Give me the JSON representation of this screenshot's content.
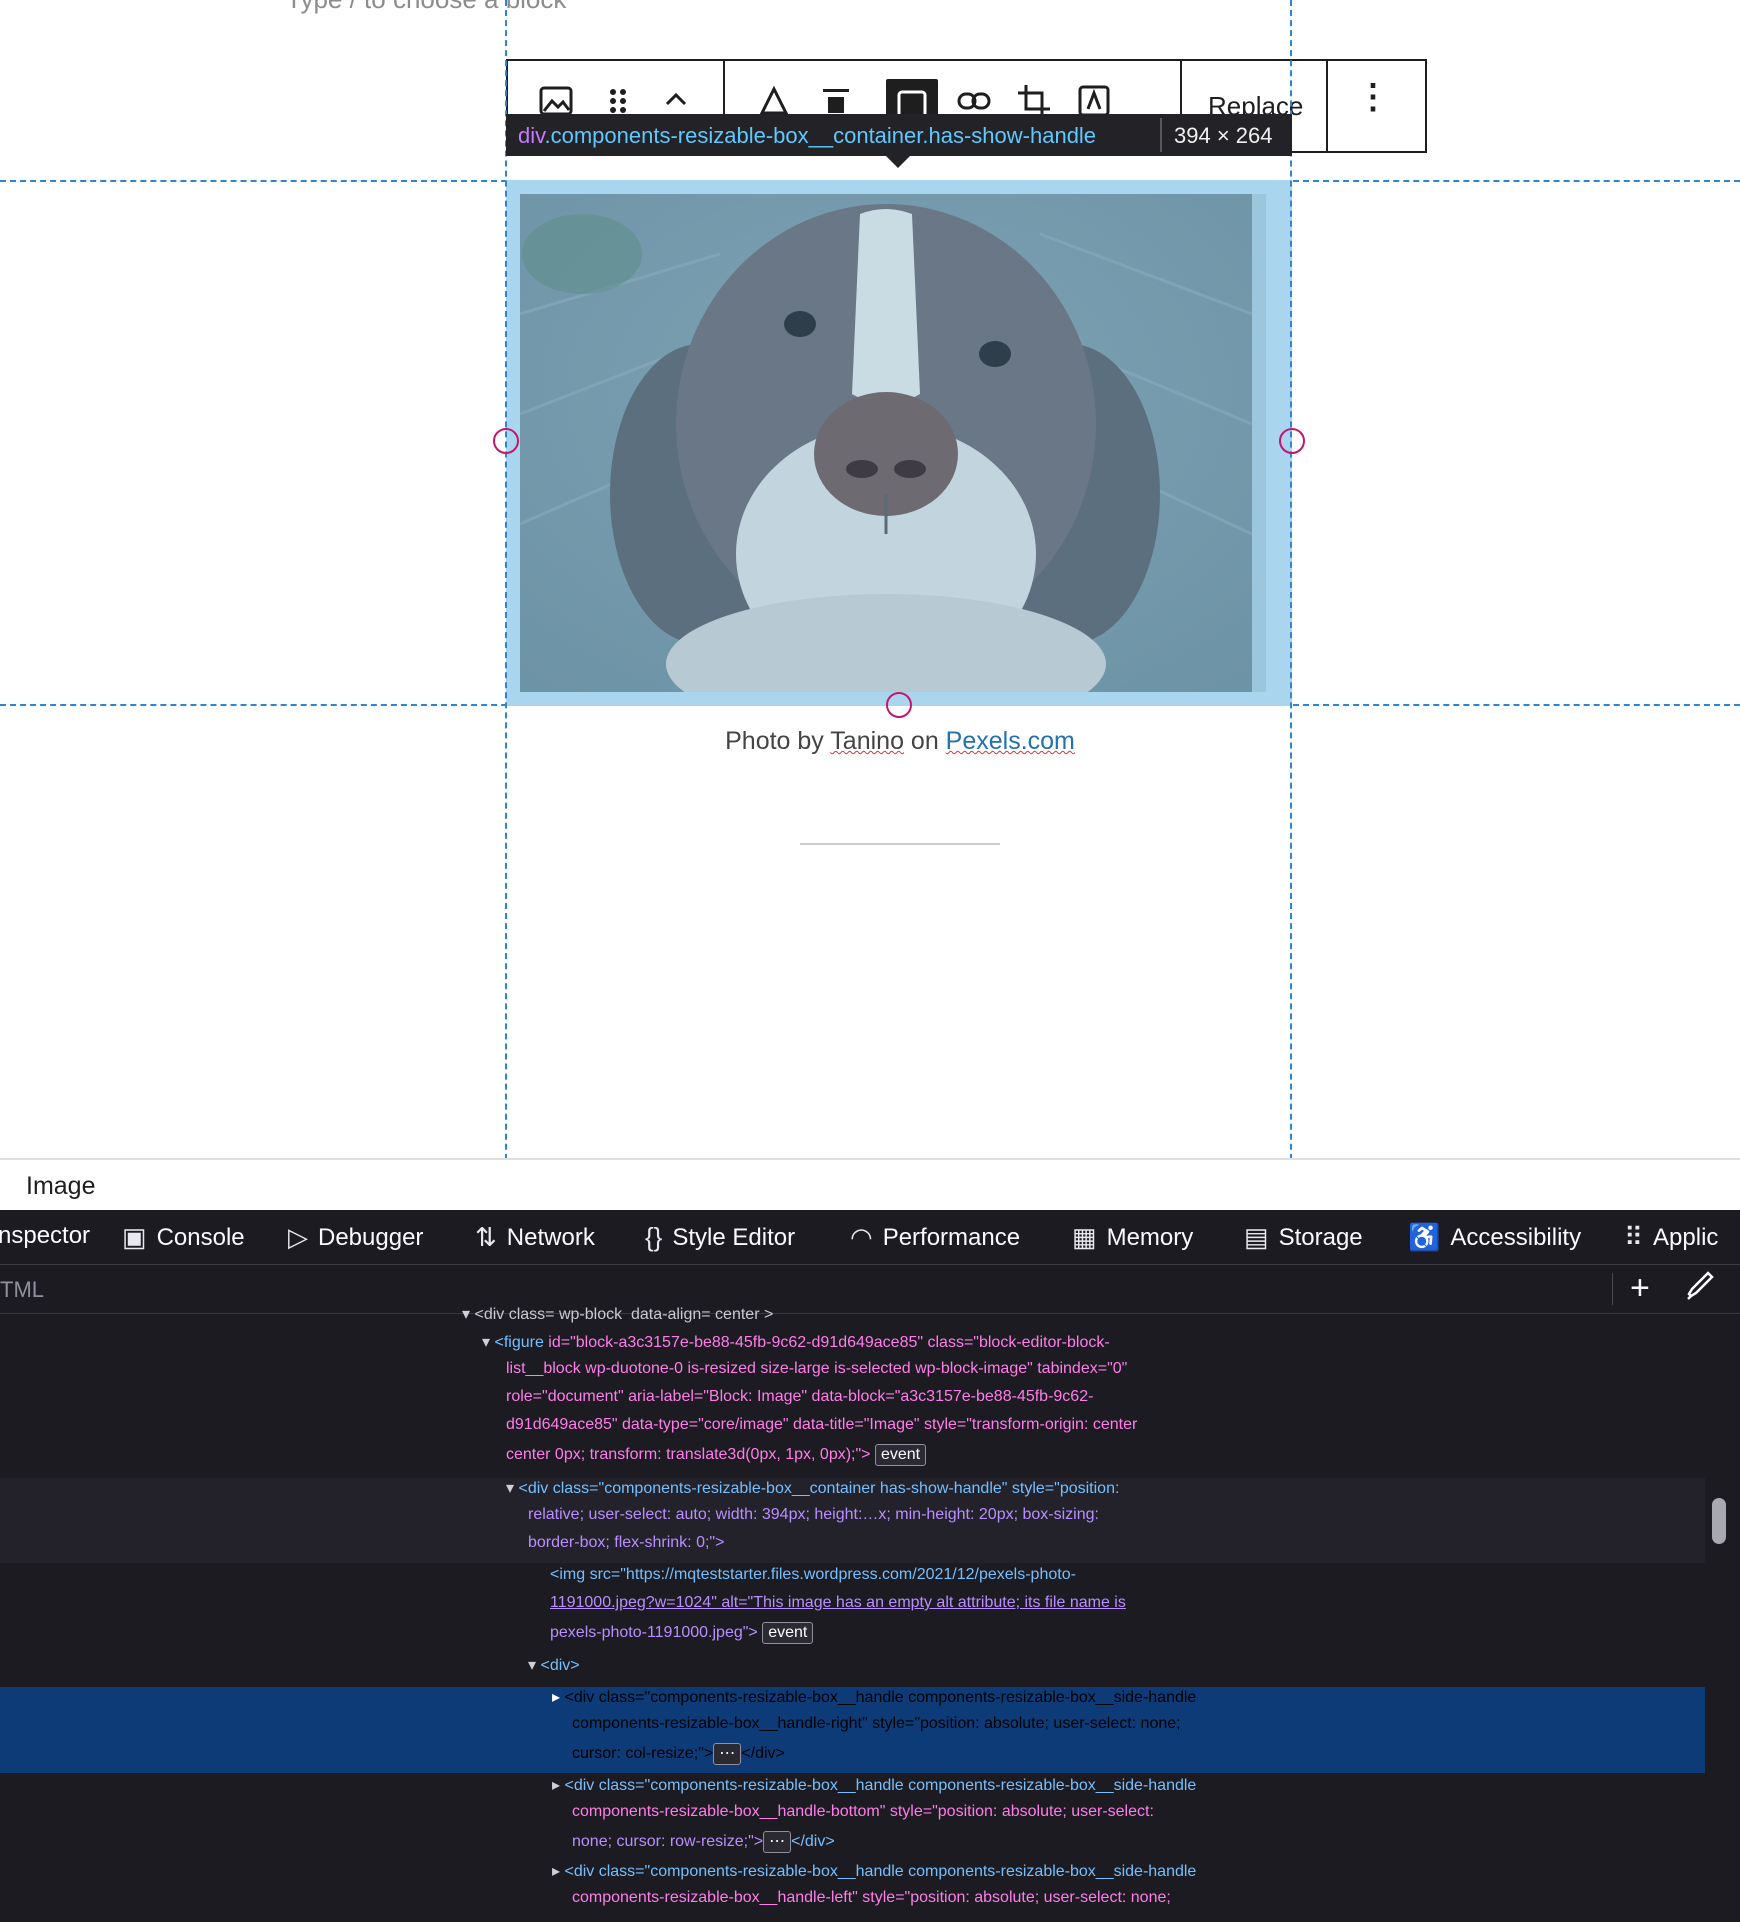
{
  "editor": {
    "placeholder": "Type / to choose a block",
    "toolbar": {
      "replace_label": "Replace",
      "more_label": "⋮",
      "buttons": [
        {
          "name": "image-block-icon",
          "glyph": "▨"
        },
        {
          "name": "drag-handle-icon",
          "glyph": "⠿"
        },
        {
          "name": "move-up-icon",
          "glyph": "⌃"
        },
        {
          "name": "duotone-icon",
          "glyph": "◭"
        },
        {
          "name": "align-icon",
          "glyph": "▬"
        },
        {
          "name": "crop-box-icon",
          "glyph": "▢"
        },
        {
          "name": "link-icon",
          "glyph": "⛓"
        },
        {
          "name": "crop-icon",
          "glyph": "⌐"
        },
        {
          "name": "text-overlay-icon",
          "glyph": "A"
        }
      ]
    },
    "inspector_tooltip": {
      "tag": "div",
      "classes": ".components-resizable-box__container.has-show-handle",
      "dimensions": "394 × 264"
    },
    "caption": {
      "prefix": "Photo by ",
      "author": "Tanino",
      "middle": " on ",
      "link": "Pexels.com"
    },
    "breadcrumb": "Image"
  },
  "devtools": {
    "tabs": [
      {
        "label": "nspector",
        "icon": ""
      },
      {
        "label": "Console",
        "icon": "▣"
      },
      {
        "label": "Debugger",
        "icon": "▷"
      },
      {
        "label": "Network",
        "icon": "⇅"
      },
      {
        "label": "Style Editor",
        "icon": "{}"
      },
      {
        "label": "Performance",
        "icon": "◠"
      },
      {
        "label": "Memory",
        "icon": "▦"
      },
      {
        "label": "Storage",
        "icon": "▤"
      },
      {
        "label": "Accessibility",
        "icon": "♿"
      },
      {
        "label": "Applic",
        "icon": "⠿"
      }
    ],
    "search_placeholder": "TML",
    "code": {
      "l0": "<div class= wp-block  data-align= center >",
      "figure_tag": "<figure",
      "figure_attrs": [
        " id=\"block-a3c3157e-be88-45fb-9c62-d91d649ace85\" class=\"block-editor-block-",
        "list__block wp-duotone-0 is-resized size-large is-selected wp-block-image\" tabindex=\"0\"",
        "role=\"document\" aria-label=\"Block: Image\" data-block=\"a3c3157e-be88-45fb-9c62-",
        "d91d649ace85\" data-type=\"core/image\" data-title=\"Image\" style=\"transform-origin: center",
        "center 0px; transform: translate3d(0px, 1px, 0px);\">"
      ],
      "div_lines": [
        "<div class=\"components-resizable-box__container has-show-handle\" style=\"position:",
        "relative; user-select: auto; width: 394px; height:…x; min-height: 20px; box-sizing:",
        "border-box; flex-shrink: 0;\">"
      ],
      "img_lines": [
        "<img src=\"https://mqteststarter.files.wordpress.com/2021/12/pexels-photo-",
        "1191000.jpeg?w=1024\" alt=\"This image has an empty alt attribute; its file name is",
        "pexels-photo-1191000.jpeg\">"
      ],
      "inner_div": "<div>",
      "handle_right": [
        "<div class=\"components-resizable-box__handle components-resizable-box__side-handle",
        "components-resizable-box__handle-right\" style=\"position: absolute; user-select: none;",
        "cursor: col-resize;\">",
        "</div>"
      ],
      "handle_bottom": [
        "<div class=\"components-resizable-box__handle components-resizable-box__side-handle",
        "components-resizable-box__handle-bottom\" style=\"position: absolute; user-select:",
        "none; cursor: row-resize;\">",
        "</div>"
      ],
      "handle_left": [
        "<div class=\"components-resizable-box__handle components-resizable-box__side-handle",
        "components-resizable-box__handle-left\" style=\"position: absolute; user-select: none;"
      ],
      "event_badge": "event",
      "ellipsis_badge": "⋯"
    }
  },
  "colors": {
    "highlight": "#a9d5ee",
    "guide": "#2d86d2",
    "handle": "#c4176c",
    "devtools_bg": "#1c1b22",
    "selected_row": "#0d3b78"
  }
}
